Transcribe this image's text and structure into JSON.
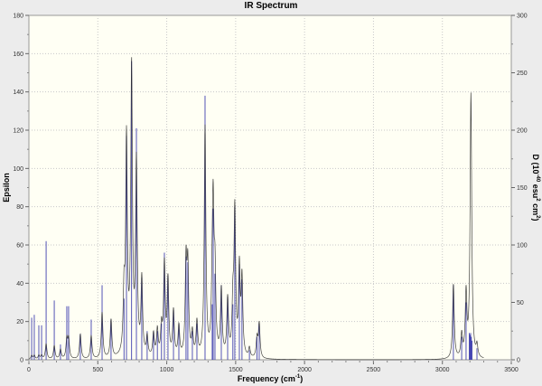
{
  "chart_data": {
    "type": "line",
    "title": "IR Spectrum",
    "xlabel": "Frequency (cm",
    "xlabel_sup": "-1",
    "xlabel_end": ")",
    "ylabel": "Epsilon",
    "ylabel_right": "D (10",
    "ylabel_right_parts": [
      "-40",
      " esu",
      "2",
      " cm",
      "2",
      ")"
    ],
    "xlim": [
      0,
      3500
    ],
    "ylim": [
      0,
      180
    ],
    "ylim_right": [
      0,
      300
    ],
    "xticks": [
      0,
      500,
      1000,
      1500,
      2000,
      2500,
      3000,
      3500
    ],
    "yticks": [
      0,
      20,
      40,
      60,
      80,
      100,
      120,
      140,
      160,
      180
    ],
    "yticks_right": [
      0,
      50,
      100,
      150,
      200,
      250,
      300
    ],
    "grid": true,
    "colors": {
      "plot_bg": "#fffff4",
      "sticks": "#4040b0",
      "curve": "#222222",
      "grid": "#c8c8c8"
    },
    "sticks": [
      [
        20,
        22
      ],
      [
        39,
        23.5
      ],
      [
        72,
        18
      ],
      [
        92,
        18
      ],
      [
        125,
        62
      ],
      [
        184,
        31
      ],
      [
        229,
        8
      ],
      [
        275,
        28
      ],
      [
        288,
        28
      ],
      [
        373,
        13.5
      ],
      [
        452,
        21
      ],
      [
        531,
        39
      ],
      [
        596,
        21
      ],
      [
        690,
        32
      ],
      [
        708,
        117
      ],
      [
        745,
        156
      ],
      [
        780,
        121
      ],
      [
        819,
        43
      ],
      [
        858,
        15
      ],
      [
        904,
        15
      ],
      [
        932,
        15
      ],
      [
        962,
        19
      ],
      [
        983,
        56
      ],
      [
        1009,
        44
      ],
      [
        1049,
        26
      ],
      [
        1088,
        19
      ],
      [
        1140,
        54
      ],
      [
        1153,
        51
      ],
      [
        1186,
        15
      ],
      [
        1219,
        19
      ],
      [
        1278,
        138
      ],
      [
        1330,
        29
      ],
      [
        1337,
        79
      ],
      [
        1350,
        45
      ],
      [
        1396,
        39
      ],
      [
        1442,
        33
      ],
      [
        1480,
        29
      ],
      [
        1494,
        80
      ],
      [
        1527,
        50
      ],
      [
        1546,
        42
      ],
      [
        1600,
        5
      ],
      [
        1655,
        12
      ],
      [
        1671,
        19
      ],
      [
        3080,
        39
      ],
      [
        3140,
        12
      ],
      [
        3172,
        30
      ],
      [
        3195,
        14
      ],
      [
        3200,
        13
      ],
      [
        3205,
        14
      ],
      [
        3210,
        12
      ],
      [
        3215,
        10
      ],
      [
        3251,
        6
      ]
    ],
    "curve_peaks": [
      [
        20,
        2
      ],
      [
        39,
        2
      ],
      [
        72,
        2
      ],
      [
        92,
        2
      ],
      [
        125,
        8
      ],
      [
        184,
        7
      ],
      [
        229,
        5
      ],
      [
        275,
        10
      ],
      [
        288,
        10
      ],
      [
        373,
        13
      ],
      [
        452,
        12
      ],
      [
        531,
        24
      ],
      [
        596,
        20
      ],
      [
        690,
        30
      ],
      [
        708,
        112
      ],
      [
        745,
        150
      ],
      [
        780,
        100
      ],
      [
        819,
        40
      ],
      [
        858,
        10
      ],
      [
        904,
        12
      ],
      [
        932,
        14
      ],
      [
        962,
        15
      ],
      [
        983,
        48
      ],
      [
        1009,
        40
      ],
      [
        1049,
        24
      ],
      [
        1088,
        16
      ],
      [
        1140,
        48
      ],
      [
        1153,
        45
      ],
      [
        1186,
        12
      ],
      [
        1219,
        18
      ],
      [
        1278,
        120
      ],
      [
        1330,
        25
      ],
      [
        1337,
        70
      ],
      [
        1350,
        40
      ],
      [
        1396,
        35
      ],
      [
        1442,
        30
      ],
      [
        1480,
        25
      ],
      [
        1494,
        75
      ],
      [
        1527,
        45
      ],
      [
        1546,
        40
      ],
      [
        1600,
        5
      ],
      [
        1655,
        10
      ],
      [
        1671,
        18
      ],
      [
        3080,
        39
      ],
      [
        3140,
        12
      ],
      [
        3172,
        33
      ],
      [
        3207,
        138
      ],
      [
        3251,
        6
      ]
    ]
  }
}
